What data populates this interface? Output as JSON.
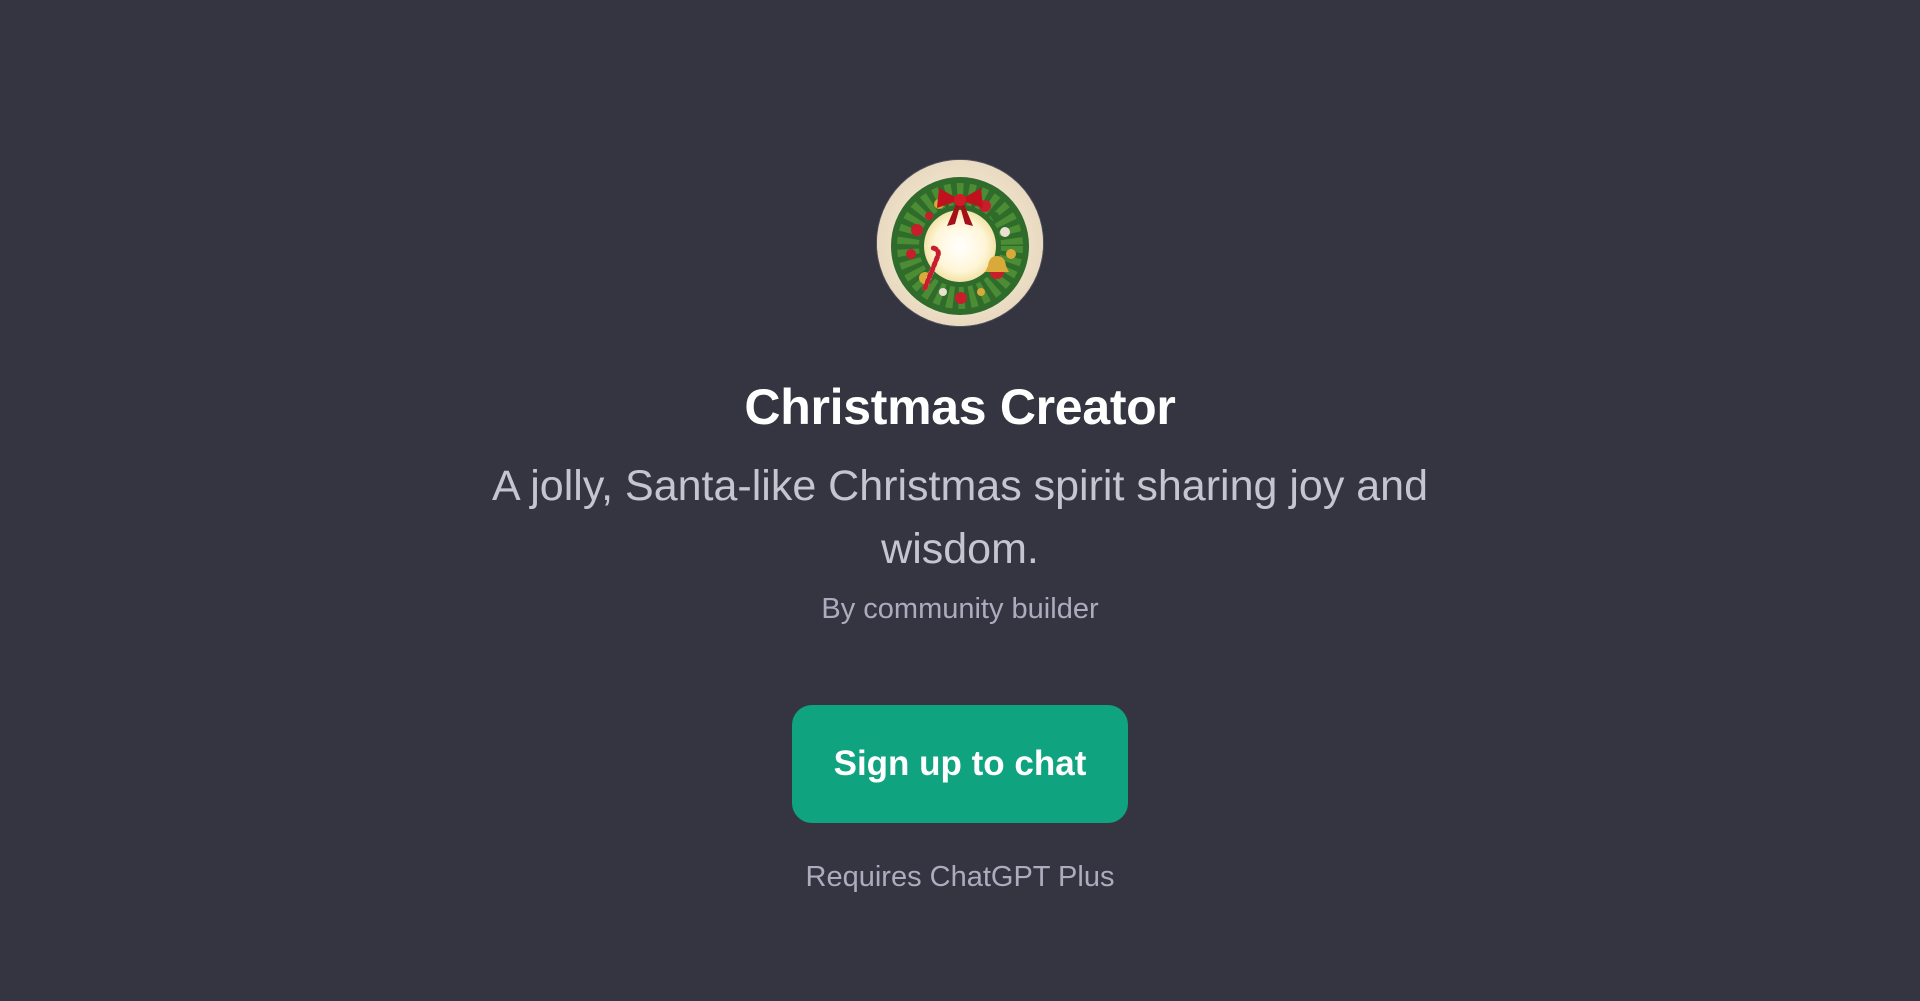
{
  "gpt": {
    "avatar_icon": "christmas-wreath",
    "title": "Christmas Creator",
    "description": "A jolly, Santa-like Christmas spirit sharing joy and wisdom.",
    "byline": "By community builder"
  },
  "actions": {
    "signup_label": "Sign up to chat"
  },
  "footer": {
    "requirement": "Requires ChatGPT Plus"
  },
  "colors": {
    "background": "#343541",
    "accent": "#10a37f",
    "title": "#ffffff",
    "muted": "#acacbe"
  }
}
